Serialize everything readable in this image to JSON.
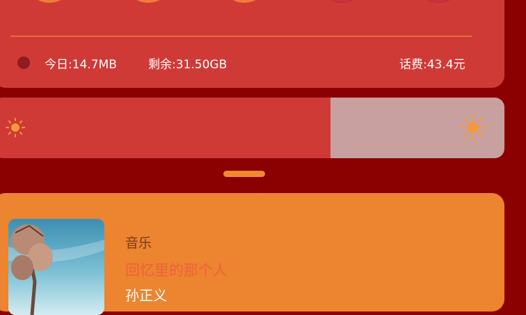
{
  "colors": {
    "background": "#8b0000",
    "card_red": "#d03a36",
    "accent_orange": "#ef7d35",
    "music_card": "#ec8430",
    "song_title": "#f0603a",
    "brightness_track": "#c9a0a0"
  },
  "quick_toggles": [
    {
      "name": "toggle-1",
      "state": "on"
    },
    {
      "name": "toggle-2",
      "state": "on"
    },
    {
      "name": "toggle-3",
      "state": "on"
    },
    {
      "name": "toggle-4",
      "state": "off"
    },
    {
      "name": "toggle-5",
      "state": "off"
    }
  ],
  "usage": {
    "today": "今日:14.7MB",
    "remaining": "剩余:31.50GB",
    "balance": "话费:43.4元"
  },
  "brightness": {
    "level": 0.34,
    "min_icon": "sun-small-icon",
    "max_icon": "sun-large-icon"
  },
  "music": {
    "app_label": "音乐",
    "song_title": "回忆里的那个人",
    "artist": "孙正义"
  }
}
